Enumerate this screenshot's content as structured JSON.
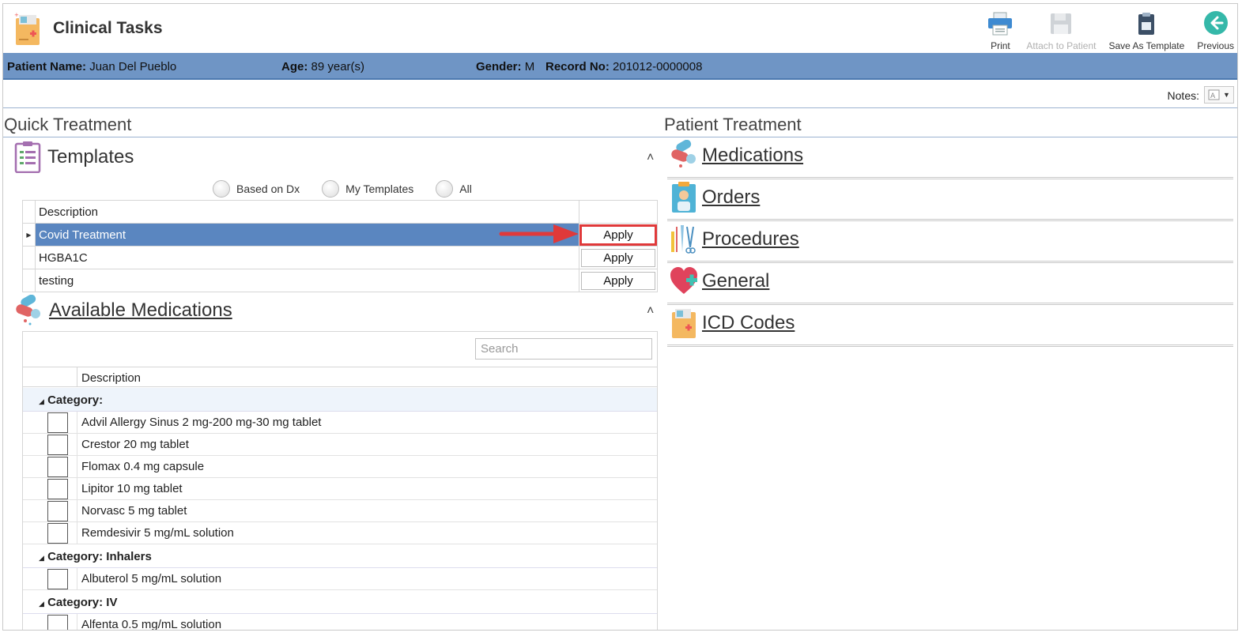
{
  "app": {
    "title": "Clinical Tasks"
  },
  "toolbar": {
    "print": "Print",
    "attach": "Attach to Patient",
    "save_template": "Save As Template",
    "previous": "Previous"
  },
  "patient": {
    "name_label": "Patient Name:",
    "name": "Juan Del Pueblo",
    "age_label": "Age:",
    "age": "89 year(s)",
    "gender_label": "Gender:",
    "gender": "M",
    "record_label": "Record No:",
    "record": "201012-0000008"
  },
  "notes": {
    "label": "Notes:"
  },
  "quick_treatment": {
    "title": "Quick Treatment",
    "templates": {
      "title": "Templates",
      "filters": [
        "Based on Dx",
        "My Templates",
        "All"
      ],
      "column": "Description",
      "rows": [
        {
          "description": "Covid Treatment",
          "action": "Apply"
        },
        {
          "description": "HGBA1C",
          "action": "Apply"
        },
        {
          "description": "testing",
          "action": "Apply"
        }
      ]
    },
    "medications": {
      "title": "Available Medications",
      "search_placeholder": "Search",
      "column": "Description",
      "categories": [
        {
          "label": "Category:",
          "items": [
            "Advil Allergy Sinus 2 mg-200 mg-30 mg tablet",
            "Crestor 20 mg tablet",
            "Flomax 0.4 mg capsule",
            "Lipitor 10 mg tablet",
            "Norvasc 5 mg tablet",
            "Remdesivir 5 mg/mL solution"
          ]
        },
        {
          "label": "Category: Inhalers",
          "items": [
            "Albuterol 5 mg/mL solution"
          ]
        },
        {
          "label": "Category: IV",
          "items": [
            "Alfenta 0.5 mg/mL solution"
          ]
        }
      ]
    }
  },
  "patient_treatment": {
    "title": "Patient Treatment",
    "items": [
      "Medications",
      "Orders",
      "Procedures",
      "General",
      "ICD Codes"
    ]
  },
  "colors": {
    "patient_bar": "#6f95c5",
    "selected_row": "#5a86c0",
    "highlight": "#e0393a"
  }
}
